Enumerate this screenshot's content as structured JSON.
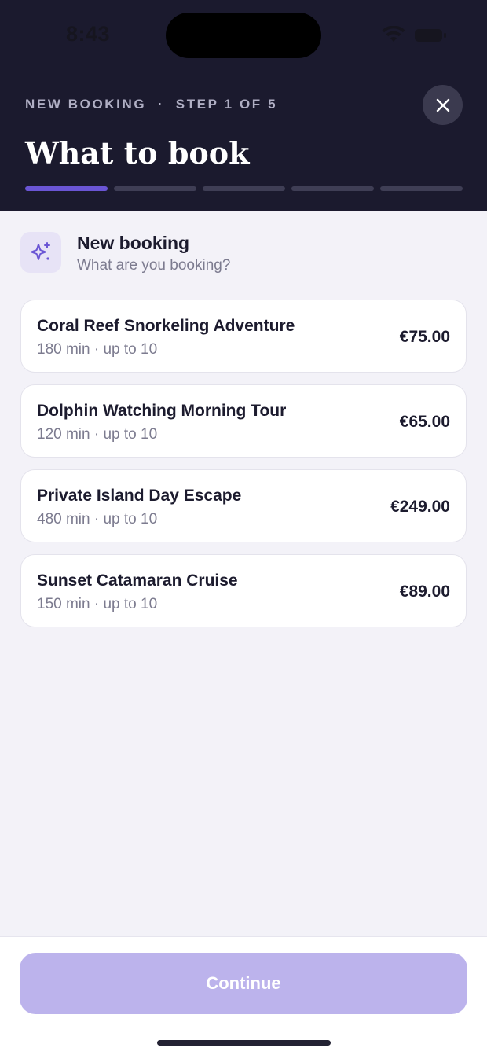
{
  "status_bar": {
    "time": "8:43"
  },
  "header": {
    "eyebrow": "NEW BOOKING  ·  STEP 1 OF 5",
    "title": "What to book",
    "step_current": 1,
    "step_total": 5
  },
  "intro": {
    "icon": "sparkles-icon",
    "title": "New booking",
    "subtitle": "What are you booking?"
  },
  "services": [
    {
      "name": "Coral Reef Snorkeling Adventure",
      "meta": "180 min · up to 10",
      "price": "€75.00"
    },
    {
      "name": "Dolphin Watching Morning Tour",
      "meta": "120 min · up to 10",
      "price": "€65.00"
    },
    {
      "name": "Private Island Day Escape",
      "meta": "480 min · up to 10",
      "price": "€249.00"
    },
    {
      "name": "Sunset Catamaran Cruise",
      "meta": "150 min · up to 10",
      "price": "€89.00"
    }
  ],
  "footer": {
    "continue_label": "Continue"
  },
  "colors": {
    "header_bg": "#1b1a2e",
    "accent": "#6a55d4",
    "continue_disabled": "#bcb3ec",
    "page_bg": "#f3f2f8"
  }
}
